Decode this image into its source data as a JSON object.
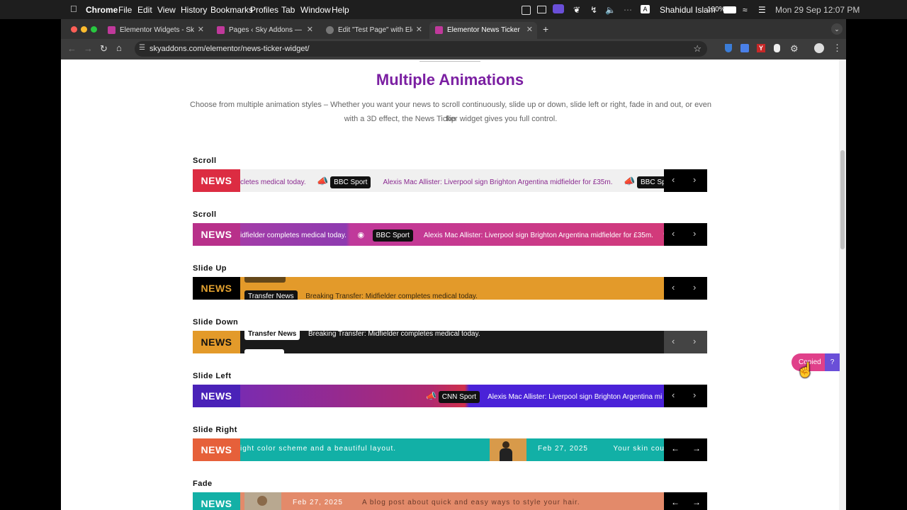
{
  "menubar": {
    "app": "Chrome",
    "items": [
      "File",
      "Edit",
      "View",
      "History",
      "Bookmarks",
      "Profiles",
      "Tab",
      "Window",
      "Help"
    ],
    "user": "Shahidul Islam",
    "battery": "100%",
    "datetime": "Mon 29 Sep  12:07 PM",
    "input_source": "A"
  },
  "tabs": [
    {
      "title": "Elementor Widgets - Sky Addo",
      "favicon_color": "#c0399b"
    },
    {
      "title": "Pages ‹ Sky Addons — WordP",
      "favicon_color": "#c0399b"
    },
    {
      "title": "Edit \"Test Page\" with Elemento",
      "favicon_color": "#888888"
    },
    {
      "title": "Elementor News Ticker Widget",
      "favicon_color": "#c0399b"
    }
  ],
  "toolbar": {
    "url": "skyaddons.com/elementor/news-ticker-widget/"
  },
  "section": {
    "title": "Multiple Animations",
    "description_line1": "Choose from multiple animation styles – Whether you want your news to scroll continuously, slide up or down, slide left or right, fade in and out, or even flip",
    "description_line2": "with a 3D effect, the News Ticker widget gives you full control."
  },
  "tickers": [
    {
      "label": "Scroll",
      "badge": "NEWS",
      "badge_color": "#dc2c42",
      "text1": "cletes medical today.",
      "chip1": "BBC Sport",
      "text2": "Alexis Mac Allister: Liverpool sign Brighton Argentina midfielder for £35m.",
      "chip2": "BBC Sport"
    },
    {
      "label": "Scroll",
      "badge": "NEWS",
      "text1": "idfielder completes medical today.",
      "chip1": "BBC Sport",
      "text2": "Alexis Mac Allister: Liverpool sign Brighton Argentina midfielder for £35m."
    },
    {
      "label": "Slide Up",
      "badge": "NEWS",
      "badge_color": "#000000",
      "chip1": "Transfer News",
      "text1": "Breaking Transfer: Midfielder completes medical today."
    },
    {
      "label": "Slide Down",
      "badge": "NEWS",
      "badge_color": "#e39a2a",
      "chip1": "Transfer News",
      "text1": "Breaking Transfer: Midfielder completes medical today."
    },
    {
      "label": "Slide Left",
      "badge": "NEWS",
      "chip1": "CNN Sport",
      "text1": "Alexis Mac Allister: Liverpool sign Brighton Argentina mi"
    },
    {
      "label": "Slide Right",
      "badge": "NEWS",
      "badge_color": "#e6603a",
      "text1": "ight color scheme and a beautiful layout.",
      "date": "Feb 27, 2025",
      "text2": "Your skin cou"
    },
    {
      "label": "Fade",
      "badge": "NEWS",
      "badge_color": "#13b0a6",
      "date": "Feb 27, 2025",
      "text1": "A blog post about quick and easy ways to style your hair."
    }
  ],
  "copied_toast": {
    "label": "Copied",
    "help": "?"
  }
}
